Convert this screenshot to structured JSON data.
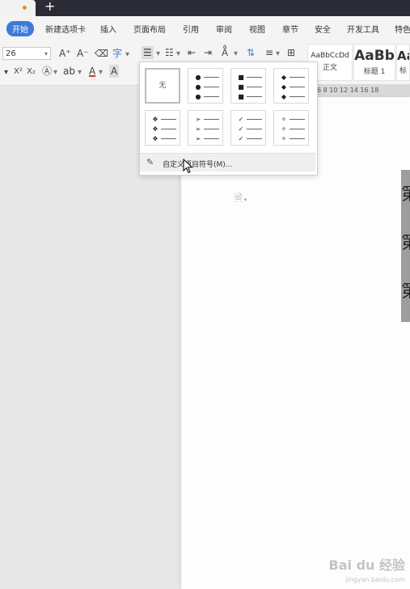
{
  "menu": {
    "items": [
      "开始",
      "新建选项卡",
      "插入",
      "页面布局",
      "引用",
      "审阅",
      "视图",
      "章节",
      "安全",
      "开发工具",
      "特色"
    ]
  },
  "toolbar": {
    "font_size": "26",
    "grow_font": "A⁺",
    "shrink_font": "A⁻",
    "superscript": "X²",
    "subscript": "X₂",
    "font_color": "A",
    "char_shading": "A"
  },
  "styles": [
    {
      "sample": "AaBbCcDd",
      "name": "正文"
    },
    {
      "sample": "AaBb",
      "name": "标题 1"
    },
    {
      "sample": "Aa",
      "name": "标"
    }
  ],
  "ruler": {
    "ticks": "6    8    10   12   14   16   18"
  },
  "bullets": {
    "none_label": "无",
    "custom_label": "自定义项目符号(M)...",
    "glyphs": [
      "●",
      "■",
      "◆",
      "❖",
      "➢",
      "✓",
      "✧"
    ]
  },
  "document": {
    "visible_chars": [
      "第",
      "第",
      "第"
    ]
  },
  "watermark": {
    "brand": "Bai du 经验",
    "url": "jingyan.baidu.com"
  },
  "colors": {
    "accent": "#3d7bd9",
    "titlebar": "#2b2b35"
  }
}
